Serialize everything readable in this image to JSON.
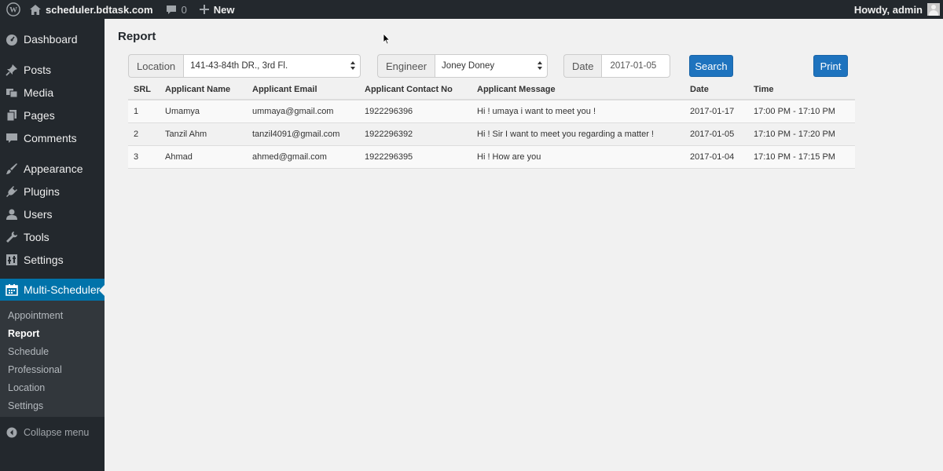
{
  "adminbar": {
    "site_name": "scheduler.bdtask.com",
    "comments_count": "0",
    "new_label": "New",
    "greeting": "Howdy, admin"
  },
  "sidebar": {
    "items": [
      {
        "label": "Dashboard",
        "icon": "dashboard-icon"
      },
      {
        "label": "Posts",
        "icon": "pin-icon"
      },
      {
        "label": "Media",
        "icon": "media-icon"
      },
      {
        "label": "Pages",
        "icon": "pages-icon"
      },
      {
        "label": "Comments",
        "icon": "comment-icon"
      },
      {
        "label": "Appearance",
        "icon": "brush-icon"
      },
      {
        "label": "Plugins",
        "icon": "plug-icon"
      },
      {
        "label": "Users",
        "icon": "user-icon"
      },
      {
        "label": "Tools",
        "icon": "wrench-icon"
      },
      {
        "label": "Settings",
        "icon": "settings-icon"
      },
      {
        "label": "Multi-Scheduler",
        "icon": "calendar-icon"
      }
    ],
    "submenu": [
      "Appointment",
      "Report",
      "Schedule",
      "Professional",
      "Location",
      "Settings"
    ],
    "current_submenu": "Report",
    "collapse_label": "Collapse menu",
    "active_color": "#0073aa"
  },
  "page": {
    "title": "Report"
  },
  "filters": {
    "location_label": "Location",
    "location_value": "141-43-84th DR., 3rd Fl.",
    "engineer_label": "Engineer",
    "engineer_value": "Joney Doney",
    "date_label": "Date",
    "date_value": "2017-01-05",
    "search_label": "Search",
    "print_label": "Print"
  },
  "table": {
    "headers": [
      "SRL",
      "Applicant Name",
      "Applicant Email",
      "Applicant Contact No",
      "Applicant Message",
      "Date",
      "Time"
    ],
    "rows": [
      [
        "1",
        "Umamya",
        "ummaya@gmail.com",
        "1922296396",
        "Hi ! umaya i want to meet you !",
        "2017-01-17",
        "17:00 PM - 17:10 PM"
      ],
      [
        "2",
        "Tanzil Ahm",
        "tanzil4091@gmail.com",
        "1922296392",
        "Hi ! Sir I want to meet you regarding a matter !",
        "2017-01-05",
        "17:10 PM - 17:20 PM"
      ],
      [
        "3",
        "Ahmad",
        "ahmed@gmail.com",
        "1922296395",
        "Hi ! How are you",
        "2017-01-04",
        "17:10 PM - 17:15 PM"
      ]
    ]
  },
  "colors": {
    "button_blue": "#1e73be",
    "sidebar_bg": "#23282d"
  }
}
